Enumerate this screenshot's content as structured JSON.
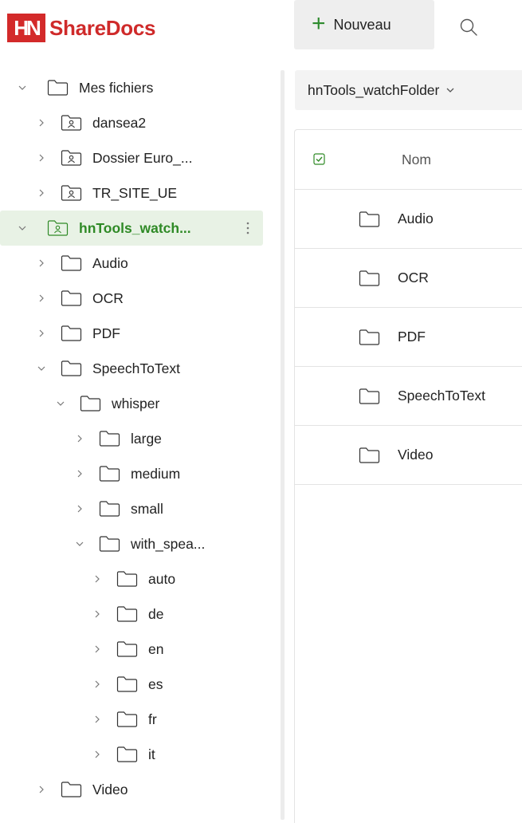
{
  "app": {
    "logo_letters": "HN",
    "title": "ShareDocs"
  },
  "toolbar": {
    "new_label": "Nouveau"
  },
  "colors": {
    "brand": "#cf2a2a",
    "accent_green": "#2f8a26",
    "selected_bg": "#e8f2e5"
  },
  "tree": [
    {
      "label": "Mes fichiers",
      "level": 0,
      "expanded": true,
      "icon": "folder-icon"
    },
    {
      "label": "dansea2",
      "level": 1,
      "expanded": false,
      "icon": "shared-folder-icon"
    },
    {
      "label": "Dossier Euro_...",
      "level": 1,
      "expanded": false,
      "icon": "shared-folder-icon"
    },
    {
      "label": "TR_SITE_UE",
      "level": 1,
      "expanded": false,
      "icon": "shared-folder-icon"
    },
    {
      "label": "hnTools_watch...",
      "level": 0,
      "expanded": true,
      "icon": "shared-folder-icon",
      "selected": true
    },
    {
      "label": "Audio",
      "level": 1,
      "expanded": false,
      "icon": "folder-icon"
    },
    {
      "label": "OCR",
      "level": 1,
      "expanded": false,
      "icon": "folder-icon"
    },
    {
      "label": "PDF",
      "level": 1,
      "expanded": false,
      "icon": "folder-icon"
    },
    {
      "label": "SpeechToText",
      "level": 1,
      "expanded": true,
      "icon": "folder-icon"
    },
    {
      "label": "whisper",
      "level": 2,
      "expanded": true,
      "icon": "folder-icon"
    },
    {
      "label": "large",
      "level": 3,
      "expanded": false,
      "icon": "folder-icon"
    },
    {
      "label": "medium",
      "level": 3,
      "expanded": false,
      "icon": "folder-icon"
    },
    {
      "label": "small",
      "level": 3,
      "expanded": false,
      "icon": "folder-icon"
    },
    {
      "label": "with_spea...",
      "level": 3,
      "expanded": true,
      "icon": "folder-icon"
    },
    {
      "label": "auto",
      "level": 4,
      "expanded": false,
      "icon": "folder-icon"
    },
    {
      "label": "de",
      "level": 4,
      "expanded": false,
      "icon": "folder-icon"
    },
    {
      "label": "en",
      "level": 4,
      "expanded": false,
      "icon": "folder-icon"
    },
    {
      "label": "es",
      "level": 4,
      "expanded": false,
      "icon": "folder-icon"
    },
    {
      "label": "fr",
      "level": 4,
      "expanded": false,
      "icon": "folder-icon"
    },
    {
      "label": "it",
      "level": 4,
      "expanded": false,
      "icon": "folder-icon"
    },
    {
      "label": "Video",
      "level": 1,
      "expanded": false,
      "icon": "folder-icon"
    }
  ],
  "main": {
    "breadcrumb": "hnTools_watchFolder",
    "column_name": "Nom",
    "rows": [
      {
        "name": "Audio",
        "icon": "folder-icon"
      },
      {
        "name": "OCR",
        "icon": "folder-icon"
      },
      {
        "name": "PDF",
        "icon": "folder-icon"
      },
      {
        "name": "SpeechToText",
        "icon": "folder-icon"
      },
      {
        "name": "Video",
        "icon": "folder-icon"
      }
    ]
  }
}
